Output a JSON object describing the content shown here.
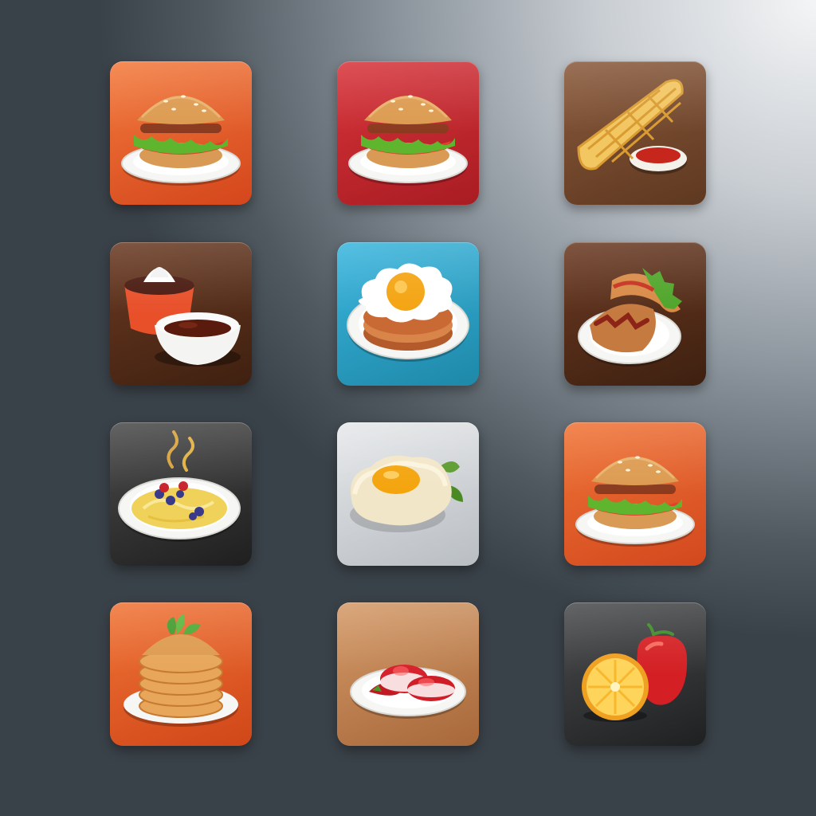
{
  "icons": [
    {
      "name": "burger-app-icon",
      "food": "burger-icon",
      "bg": [
        "#f37a3c",
        "#d4461c"
      ]
    },
    {
      "name": "burger-app-icon-red",
      "food": "burger-icon",
      "bg": [
        "#d8343a",
        "#a81c22"
      ]
    },
    {
      "name": "waffle-roll-app-icon",
      "food": "waffle-roll-icon",
      "bg": [
        "#8a5a3b",
        "#5e3820"
      ]
    },
    {
      "name": "hot-chocolate-app-icon",
      "food": "hot-chocolate-icon",
      "bg": [
        "#6a3a22",
        "#3f2010"
      ]
    },
    {
      "name": "egg-pancakes-app-icon",
      "food": "egg-pancakes-icon",
      "bg": [
        "#3ab6de",
        "#1e88a8"
      ]
    },
    {
      "name": "sandwich-app-icon",
      "food": "sandwich-plate-icon",
      "bg": [
        "#6b3a22",
        "#3e2010"
      ]
    },
    {
      "name": "porridge-app-icon",
      "food": "porridge-icon",
      "bg": [
        "#4a4a4a",
        "#1f1f1f"
      ]
    },
    {
      "name": "fried-egg-app-icon",
      "food": "fried-egg-icon",
      "bg": [
        "#e6e8ea",
        "#b9bec3"
      ]
    },
    {
      "name": "burger-app-icon-orange",
      "food": "burger-icon",
      "bg": [
        "#f07436",
        "#d2481e"
      ]
    },
    {
      "name": "pancake-stack-app-icon",
      "food": "pancake-stack-icon",
      "bg": [
        "#f07436",
        "#d04618"
      ]
    },
    {
      "name": "berry-dessert-app-icon",
      "food": "berry-dessert-icon",
      "bg": [
        "#d49a68",
        "#a8683a"
      ]
    },
    {
      "name": "fruit-app-icon",
      "food": "fruit-icon",
      "bg": [
        "#4a4c4e",
        "#1e2022"
      ]
    }
  ]
}
